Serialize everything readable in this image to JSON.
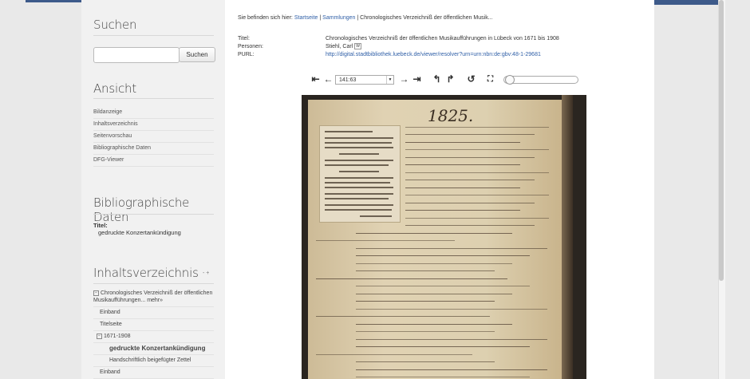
{
  "sidebar": {
    "search": {
      "title": "Suchen",
      "button": "Suchen",
      "placeholder": ""
    },
    "view": {
      "title": "Ansicht",
      "items": [
        "Bildanzeige",
        "Inhaltsverzeichnis",
        "Seitenvorschau",
        "Bibliographische Daten",
        "DFG-Viewer"
      ]
    },
    "bib": {
      "title": "Bibliographische Daten",
      "field_label": "Titel:",
      "field_value": "gedruckte Konzertankündigung"
    },
    "toc": {
      "title": "Inhaltsverzeichnis",
      "toggle_label": "- +",
      "root": "Chronologisches Verzeichniß der öffentlichen Musikaufführungen... mehr»",
      "items": [
        "Einband",
        "Titelseite"
      ],
      "group": "1671-1908",
      "active": "gedruckte Konzertankündigung",
      "sub": "Handschriftlich beigefügter Zettel",
      "last": "Einband"
    }
  },
  "breadcrumb": {
    "prefix": "Sie befinden sich hier:",
    "home": "Startseite",
    "sep1": "|",
    "collections": "Sammlungen",
    "sep2": "|",
    "current": "Chronologisches Verzeichniß der öffentlichen Musik..."
  },
  "metadata": {
    "title_label": "Titel:",
    "title_value": "Chronologisches Verzeichniß der öffentlichen Musikaufführungen in Lübeck von 1671 bis 1908",
    "persons_label": "Personen:",
    "persons_value": "Stiehl, Carl",
    "purl_label": "PURL:",
    "purl_value": "http://digital.stadtbibliothek.luebeck.de/viewer/resolver?urn=urn:nbn:de:gbv:48-1-29681"
  },
  "viewer": {
    "page_select": "141:63",
    "zoom_level": 0.0,
    "icons": [
      "first-page-icon",
      "prev-page-icon",
      "next-page-icon",
      "last-page-icon",
      "rotate-left-icon",
      "rotate-right-icon",
      "reset-icon",
      "fullscreen-icon"
    ],
    "scan_year": "1825."
  },
  "colors": {
    "link": "#2f5fa7",
    "accent_bar": "#3d5a8a"
  }
}
